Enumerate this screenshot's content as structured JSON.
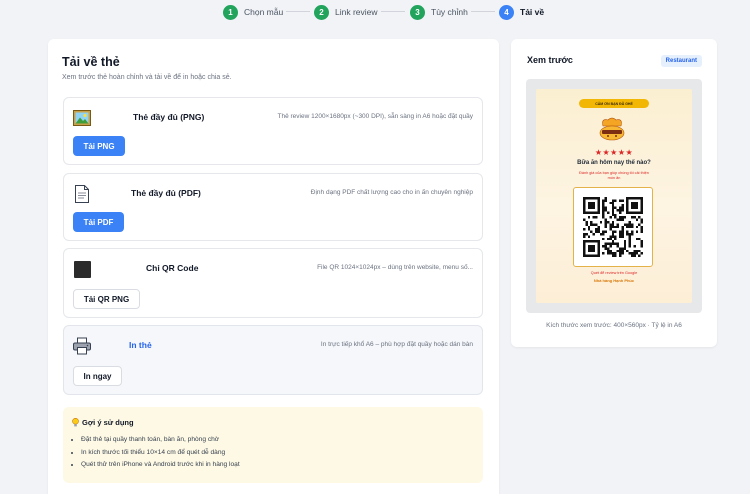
{
  "stepper": {
    "steps": [
      {
        "number": "1",
        "label": "Chọn mẫu",
        "state": "done"
      },
      {
        "number": "2",
        "label": "Link review",
        "state": "done"
      },
      {
        "number": "3",
        "label": "Tùy chỉnh",
        "state": "done"
      },
      {
        "number": "4",
        "label": "Tải về",
        "state": "active"
      }
    ]
  },
  "main": {
    "title": "Tải về thẻ",
    "subtitle": "Xem trước thẻ hoàn chỉnh và tải về để in hoặc chia sẻ.",
    "options": [
      {
        "icon": "image-icon",
        "name": "Thẻ đầy đủ (PNG)",
        "desc": "Thẻ review 1200×1680px (~300 DPI), sẵn sàng in A6 hoặc đặt quầy",
        "button": "Tải PNG"
      },
      {
        "icon": "document-icon",
        "name": "Thẻ đầy đủ (PDF)",
        "desc": "Định dạng PDF chất lượng cao cho in ấn chuyên nghiệp",
        "button": "Tải PDF"
      },
      {
        "icon": "qr-square-icon",
        "name": "Chỉ QR Code",
        "desc": "File QR 1024×1024px – dùng trên website, menu số...",
        "button": "Tải QR PNG"
      },
      {
        "icon": "printer-icon",
        "name": "In thẻ",
        "desc": "In trực tiếp khổ A6 – phù hợp đặt quầy hoặc dán bàn",
        "button": "In ngay"
      }
    ],
    "tips": {
      "icon": "lightbulb-icon",
      "title": "Gợi ý sử dụng",
      "items": [
        "Đặt thẻ tại quầy thanh toán, bàn ăn, phòng chờ",
        "In kích thước tối thiểu 10×14 cm để quét dễ dàng",
        "Quét thử trên iPhone và Android trước khi in hàng loạt"
      ]
    }
  },
  "preview": {
    "title": "Xem trước",
    "badge": "Restaurant",
    "caption": "Kích thước xem trước: 400×560px · Tỷ lệ in A6",
    "card": {
      "pill": "CẢM ƠN BẠN ĐÃ GHÉ",
      "stars": "★★★★★",
      "question": "Bữa ăn hôm nay thế nào?",
      "subtitle": "Đánh giá của bạn giúp chúng tôi cải thiện món ăn",
      "link_text": "Quét để review trên Google",
      "brand": "Nhà hàng Hạnh Phúc"
    }
  },
  "colors": {
    "done": "#22a45d",
    "active": "#3b82f6",
    "primary_button": "#3b82f6",
    "tips_bg": "#fef9e4"
  }
}
